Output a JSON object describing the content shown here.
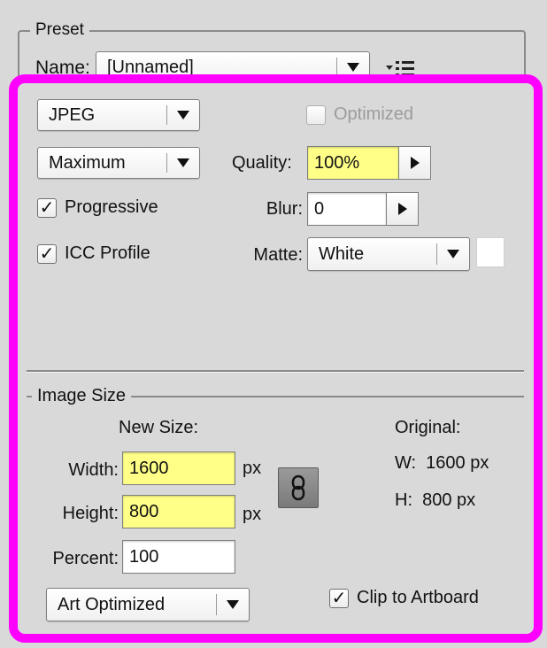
{
  "preset": {
    "legend": "Preset",
    "name_label": "Name:",
    "name_value": "[Unnamed]",
    "menu_icon": "flyout-menu-icon"
  },
  "format": {
    "file_type": "JPEG",
    "quality_preset": "Maximum",
    "optimized_label": "Optimized",
    "optimized_checked": false,
    "optimized_enabled": false,
    "progressive_label": "Progressive",
    "progressive_checked": true,
    "icc_label": "ICC Profile",
    "icc_checked": true,
    "quality_label": "Quality:",
    "quality_value": "100%",
    "blur_label": "Blur:",
    "blur_value": "0",
    "matte_label": "Matte:",
    "matte_value": "White",
    "matte_color": "#ffffff"
  },
  "image_size": {
    "legend": "Image Size",
    "new_size_label": "New Size:",
    "width_label": "Width:",
    "width_value": "1600",
    "height_label": "Height:",
    "height_value": "800",
    "unit": "px",
    "percent_label": "Percent:",
    "percent_value": "100",
    "original_label": "Original:",
    "original_w": "W:  1600 px",
    "original_h": "H:  800 px",
    "resample": "Art Optimized",
    "clip_label": "Clip to Artboard",
    "clip_checked": true,
    "link_icon": "chain-link-icon"
  },
  "colors": {
    "highlight_frame": "#ff00ff",
    "panel_bg": "#d9d9d9",
    "edited_field": "#ffff88"
  }
}
